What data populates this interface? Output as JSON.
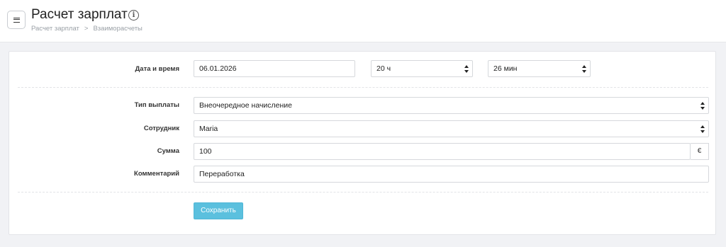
{
  "header": {
    "title": "Расчет зарплат",
    "info_icon": "info-icon",
    "menu_icon": "menu-icon",
    "breadcrumb": [
      "Расчет зарплат",
      "Взаиморасчеты"
    ],
    "breadcrumb_separator": ">"
  },
  "form": {
    "datetime": {
      "label": "Дата и время",
      "date": "06.01.2026",
      "hours": "20 ч",
      "minutes": "26 мин"
    },
    "payment_type": {
      "label": "Тип выплаты",
      "value": "Внеочередное начисление"
    },
    "employee": {
      "label": "Сотрудник",
      "value": "Maria"
    },
    "amount": {
      "label": "Сумма",
      "value": "100",
      "currency": "€"
    },
    "comment": {
      "label": "Комментарий",
      "value": "Переработка"
    },
    "save_label": "Сохранить"
  },
  "colors": {
    "accent": "#5bc0de",
    "background": "#f1f2f5"
  }
}
